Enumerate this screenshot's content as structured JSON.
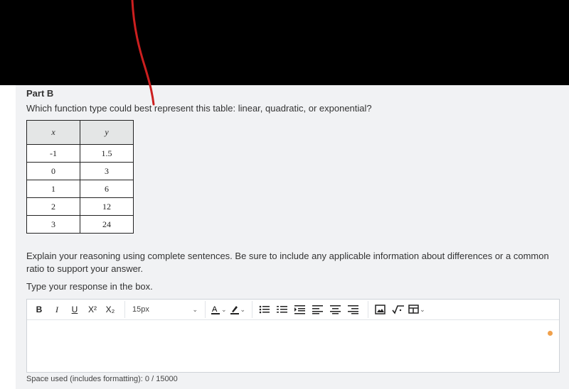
{
  "part_title": "Part B",
  "question": "Which function type could best represent this table: linear, quadratic, or exponential?",
  "table": {
    "headers": [
      "x",
      "y"
    ],
    "rows": [
      [
        "-1",
        "1.5"
      ],
      [
        "0",
        "3"
      ],
      [
        "1",
        "6"
      ],
      [
        "2",
        "12"
      ],
      [
        "3",
        "24"
      ]
    ]
  },
  "explain_text": "Explain your reasoning using complete sentences. Be sure to include any applicable information about differences or a common ratio to support your answer.",
  "type_prompt": "Type your response in the box.",
  "toolbar": {
    "bold": "B",
    "italic": "I",
    "underline": "U",
    "superscript": "X²",
    "subscript": "X₂",
    "font_size": "15px"
  },
  "counter": "Space used (includes formatting): 0 / 15000",
  "colors": {
    "annotation_line": "#cc1f1f",
    "status_dot": "#f0a04b"
  },
  "icons": [
    "chevron-down-icon",
    "text-color-icon",
    "highlight-icon",
    "bullet-list-icon",
    "numbered-list-icon",
    "indent-icon",
    "align-left-icon",
    "align-center-icon",
    "align-right-icon",
    "image-icon",
    "math-icon",
    "table-icon"
  ]
}
